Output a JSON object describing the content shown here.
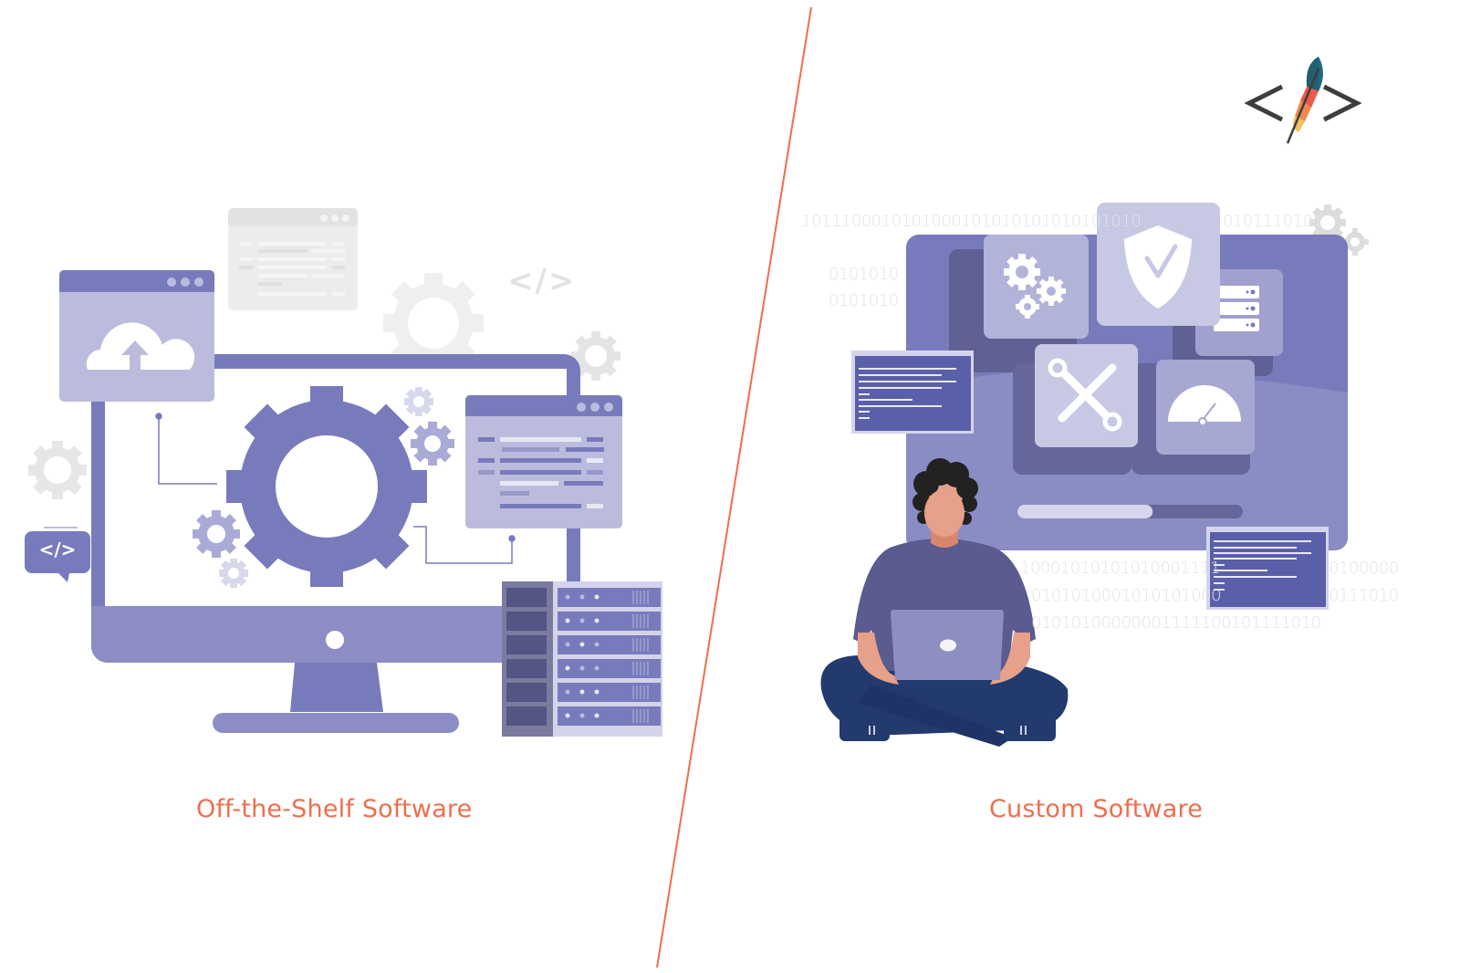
{
  "captions": {
    "left": "Off-the-Shelf Software",
    "right": "Custom Software"
  },
  "logo": {
    "left_bracket": "<",
    "right_bracket": ">",
    "icon": "feather-code-logo"
  },
  "code_badge_left": "</>",
  "code_glyph_background": "</>",
  "binary_strings": {
    "top": "1011100010101000101010101010101010",
    "top_right": "0101110101",
    "mid_1": "0101010",
    "mid_2": "0101010",
    "bottom_1_left": "10001010101010001111",
    "bottom_1_right": "0100000",
    "bottom_2_left": "0101010001010101000",
    "bottom_2_right": "0111010",
    "bottom_3": "01010100000001111100101111010"
  },
  "colors": {
    "accent": "#ee6e4d",
    "primary_purple": "#787bbb",
    "light_purple": "#bbbcdd",
    "dark_purple": "#5f6094",
    "navy": "#233a6e",
    "divider": "#ee6e4d"
  },
  "progress": {
    "value_percent": 60
  }
}
